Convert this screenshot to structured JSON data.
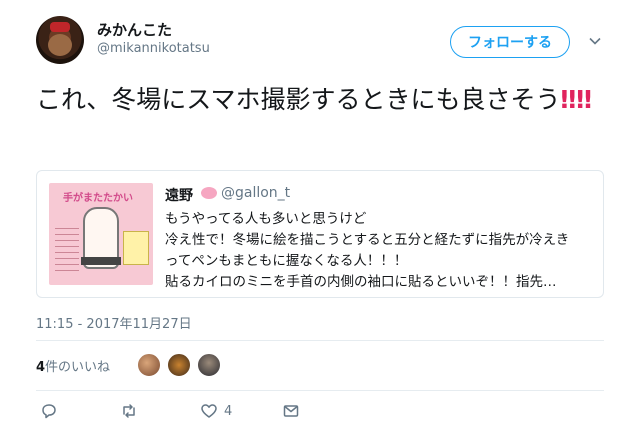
{
  "author": {
    "display_name": "みかんこた",
    "handle": "@mikannikotatsu"
  },
  "follow_label": "フォローする",
  "tweet": {
    "text": "これ、冬場にスマホ撮影するときにも良さそう",
    "emphasis": "‼‼"
  },
  "quoted": {
    "author_name": "遠野",
    "author_handle": "@gallon_t",
    "lines": [
      "もうやってる人も多いと思うけど",
      "冷え性で！冬場に絵を描こうとすると五分と経たずに指先が冷えき",
      "ってペンもまともに握なくなる人！！！",
      "貼るカイロのミニを手首の内側の袖口に貼るといいぞ！！指先…"
    ],
    "image_title": "手がまたたかい"
  },
  "timestamp": "11:15 - 2017年11月27日",
  "likes": {
    "count": "4",
    "label": "件のいいね"
  },
  "actions": {
    "reply_icon": "reply-icon",
    "retweet_icon": "retweet-icon",
    "like_icon": "heart-icon",
    "like_count": "4",
    "dm_icon": "mail-icon"
  },
  "colors": {
    "accent": "#1da1f2",
    "text": "#14171a",
    "secondary": "#657786",
    "emphasis": "#e0245e"
  }
}
